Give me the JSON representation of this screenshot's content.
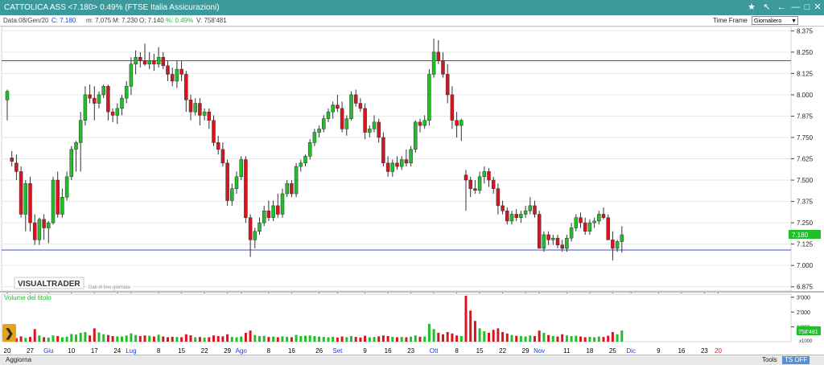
{
  "window": {
    "title": "CATTOLICA ASS <7.180> 0.49%  (FTSE Italia Assicurazioni)",
    "title_bg": "#3d9a9c"
  },
  "info": {
    "date": "Data:08/Gen/20",
    "close": "C: 7.180",
    "min": "m: 7.075",
    "max": "M: 7.230",
    "open": "O: 7.140",
    "pct": "%: 0.49%",
    "volume": "V: 758'481"
  },
  "timeframe": {
    "label": "Time Frame",
    "value": "Giornaliero"
  },
  "branding": {
    "logo": "VISUALTRADER",
    "note": "Dati di fine giornata"
  },
  "volume_panel": {
    "label": "Volume del titolo",
    "ticks": [
      "3'000",
      "2'000",
      "1'000"
    ],
    "unit": "x1000",
    "last_value": "758'481"
  },
  "price_label": "7.180",
  "bottom": {
    "refresh": "Aggiorna",
    "tools": "Tools",
    "tsoff": "TS OFF"
  },
  "colors": {
    "up": "#1fbf2a",
    "down": "#d8141f",
    "hline": "#3a4fd8",
    "volume_up": "#1fbf2a",
    "volume_down": "#d8141f"
  },
  "icons": [
    "star-icon",
    "zoom-arrow-icon",
    "pan-left-icon",
    "minimize-icon",
    "restore-icon",
    "close-icon",
    "expand-arrow-icon"
  ],
  "chart_data": {
    "type": "candlestick",
    "y_ticks": [
      "8.375",
      "8.250",
      "8.125",
      "8.000",
      "7.875",
      "7.750",
      "7.625",
      "7.500",
      "7.375",
      "7.250",
      "7.125",
      "7.000",
      "6.875"
    ],
    "ylim": [
      6.85,
      8.4
    ],
    "horizontal_lines": [
      8.2,
      7.09
    ],
    "x_labels": [
      {
        "text": "20",
        "bar": 0,
        "color": "#000000"
      },
      {
        "text": "27",
        "bar": 5,
        "color": "#000000"
      },
      {
        "text": "Giu",
        "bar": 9,
        "color": "#1a3fd8"
      },
      {
        "text": "10",
        "bar": 14,
        "color": "#000000"
      },
      {
        "text": "17",
        "bar": 19,
        "color": "#000000"
      },
      {
        "text": "24",
        "bar": 24,
        "color": "#000000"
      },
      {
        "text": "Lug",
        "bar": 27,
        "color": "#1a3fd8"
      },
      {
        "text": "8",
        "bar": 33,
        "color": "#000000"
      },
      {
        "text": "15",
        "bar": 38,
        "color": "#000000"
      },
      {
        "text": "22",
        "bar": 43,
        "color": "#000000"
      },
      {
        "text": "29",
        "bar": 48,
        "color": "#000000"
      },
      {
        "text": "Ago",
        "bar": 51,
        "color": "#1a3fd8"
      },
      {
        "text": "8",
        "bar": 57,
        "color": "#000000"
      },
      {
        "text": "16",
        "bar": 62,
        "color": "#000000"
      },
      {
        "text": "26",
        "bar": 68,
        "color": "#000000"
      },
      {
        "text": "Set",
        "bar": 72,
        "color": "#1a3fd8"
      },
      {
        "text": "9",
        "bar": 78,
        "color": "#000000"
      },
      {
        "text": "16",
        "bar": 83,
        "color": "#000000"
      },
      {
        "text": "23",
        "bar": 88,
        "color": "#000000"
      },
      {
        "text": "Ott",
        "bar": 93,
        "color": "#1a3fd8"
      },
      {
        "text": "8",
        "bar": 98,
        "color": "#000000"
      },
      {
        "text": "15",
        "bar": 103,
        "color": "#000000"
      },
      {
        "text": "22",
        "bar": 108,
        "color": "#000000"
      },
      {
        "text": "29",
        "bar": 113,
        "color": "#000000"
      },
      {
        "text": "Nov",
        "bar": 116,
        "color": "#1a3fd8"
      },
      {
        "text": "11",
        "bar": 122,
        "color": "#000000"
      },
      {
        "text": "18",
        "bar": 127,
        "color": "#000000"
      },
      {
        "text": "25",
        "bar": 132,
        "color": "#000000"
      },
      {
        "text": "Dic",
        "bar": 136,
        "color": "#1a3fd8"
      },
      {
        "text": "9",
        "bar": 142,
        "color": "#000000"
      },
      {
        "text": "16",
        "bar": 147,
        "color": "#000000"
      },
      {
        "text": "23",
        "bar": 152,
        "color": "#000000"
      },
      {
        "text": "20",
        "bar": 155,
        "color": "#e0201a"
      }
    ],
    "candles": [
      {
        "o": 7.97,
        "h": 8.03,
        "l": 7.85,
        "c": 8.02,
        "v": 300
      },
      {
        "o": 7.63,
        "h": 7.67,
        "l": 7.58,
        "c": 7.61,
        "v": 250
      },
      {
        "o": 7.6,
        "h": 7.65,
        "l": 7.5,
        "c": 7.55,
        "v": 240
      },
      {
        "o": 7.55,
        "h": 7.58,
        "l": 7.28,
        "c": 7.3,
        "v": 360
      },
      {
        "o": 7.3,
        "h": 7.5,
        "l": 7.2,
        "c": 7.48,
        "v": 260
      },
      {
        "o": 7.48,
        "h": 7.52,
        "l": 7.2,
        "c": 7.25,
        "v": 320
      },
      {
        "o": 7.25,
        "h": 7.3,
        "l": 7.12,
        "c": 7.15,
        "v": 850
      },
      {
        "o": 7.15,
        "h": 7.28,
        "l": 7.12,
        "c": 7.27,
        "v": 420
      },
      {
        "o": 7.27,
        "h": 7.3,
        "l": 7.15,
        "c": 7.22,
        "v": 300
      },
      {
        "o": 7.22,
        "h": 7.26,
        "l": 7.13,
        "c": 7.25,
        "v": 280
      },
      {
        "o": 7.25,
        "h": 7.52,
        "l": 7.24,
        "c": 7.5,
        "v": 420
      },
      {
        "o": 7.5,
        "h": 7.55,
        "l": 7.28,
        "c": 7.3,
        "v": 380
      },
      {
        "o": 7.3,
        "h": 7.45,
        "l": 7.28,
        "c": 7.4,
        "v": 300
      },
      {
        "o": 7.4,
        "h": 7.55,
        "l": 7.38,
        "c": 7.52,
        "v": 340
      },
      {
        "o": 7.52,
        "h": 7.7,
        "l": 7.5,
        "c": 7.68,
        "v": 520
      },
      {
        "o": 7.68,
        "h": 7.73,
        "l": 7.55,
        "c": 7.72,
        "v": 480
      },
      {
        "o": 7.72,
        "h": 7.9,
        "l": 7.55,
        "c": 7.85,
        "v": 600
      },
      {
        "o": 7.85,
        "h": 8.05,
        "l": 7.82,
        "c": 8.0,
        "v": 650
      },
      {
        "o": 8.0,
        "h": 8.06,
        "l": 7.95,
        "c": 7.98,
        "v": 420
      },
      {
        "o": 7.98,
        "h": 8.05,
        "l": 7.85,
        "c": 7.95,
        "v": 900
      },
      {
        "o": 7.95,
        "h": 8.02,
        "l": 7.92,
        "c": 8.0,
        "v": 620
      },
      {
        "o": 8.0,
        "h": 8.06,
        "l": 7.98,
        "c": 8.05,
        "v": 500
      },
      {
        "o": 8.05,
        "h": 8.06,
        "l": 7.85,
        "c": 7.9,
        "v": 450
      },
      {
        "o": 7.9,
        "h": 7.92,
        "l": 7.84,
        "c": 7.88,
        "v": 380
      },
      {
        "o": 7.88,
        "h": 7.95,
        "l": 7.83,
        "c": 7.92,
        "v": 360
      },
      {
        "o": 7.92,
        "h": 8.0,
        "l": 7.88,
        "c": 7.98,
        "v": 350
      },
      {
        "o": 7.98,
        "h": 8.08,
        "l": 7.95,
        "c": 8.05,
        "v": 420
      },
      {
        "o": 8.05,
        "h": 8.22,
        "l": 8.0,
        "c": 8.18,
        "v": 560
      },
      {
        "o": 8.18,
        "h": 8.26,
        "l": 8.12,
        "c": 8.22,
        "v": 450
      },
      {
        "o": 8.22,
        "h": 8.25,
        "l": 8.16,
        "c": 8.2,
        "v": 380
      },
      {
        "o": 8.2,
        "h": 8.3,
        "l": 8.17,
        "c": 8.18,
        "v": 420
      },
      {
        "o": 8.18,
        "h": 8.25,
        "l": 8.15,
        "c": 8.2,
        "v": 400
      },
      {
        "o": 8.2,
        "h": 8.24,
        "l": 8.14,
        "c": 8.18,
        "v": 350
      },
      {
        "o": 8.18,
        "h": 8.28,
        "l": 8.16,
        "c": 8.22,
        "v": 470
      },
      {
        "o": 8.22,
        "h": 8.25,
        "l": 8.15,
        "c": 8.17,
        "v": 350
      },
      {
        "o": 8.17,
        "h": 8.2,
        "l": 8.08,
        "c": 8.12,
        "v": 300
      },
      {
        "o": 8.12,
        "h": 8.16,
        "l": 8.05,
        "c": 8.08,
        "v": 330
      },
      {
        "o": 8.08,
        "h": 8.2,
        "l": 8.04,
        "c": 8.15,
        "v": 320
      },
      {
        "o": 8.15,
        "h": 8.2,
        "l": 8.08,
        "c": 8.12,
        "v": 300
      },
      {
        "o": 8.12,
        "h": 8.14,
        "l": 7.9,
        "c": 7.97,
        "v": 500
      },
      {
        "o": 7.97,
        "h": 8.0,
        "l": 7.85,
        "c": 7.9,
        "v": 430
      },
      {
        "o": 7.9,
        "h": 7.98,
        "l": 7.88,
        "c": 7.95,
        "v": 300
      },
      {
        "o": 7.95,
        "h": 7.98,
        "l": 7.82,
        "c": 7.88,
        "v": 320
      },
      {
        "o": 7.88,
        "h": 7.92,
        "l": 7.85,
        "c": 7.9,
        "v": 280
      },
      {
        "o": 7.9,
        "h": 7.92,
        "l": 7.8,
        "c": 7.85,
        "v": 300
      },
      {
        "o": 7.85,
        "h": 7.88,
        "l": 7.7,
        "c": 7.72,
        "v": 420
      },
      {
        "o": 7.72,
        "h": 7.76,
        "l": 7.65,
        "c": 7.68,
        "v": 380
      },
      {
        "o": 7.68,
        "h": 7.72,
        "l": 7.58,
        "c": 7.6,
        "v": 360
      },
      {
        "o": 7.6,
        "h": 7.62,
        "l": 7.35,
        "c": 7.38,
        "v": 500
      },
      {
        "o": 7.38,
        "h": 7.48,
        "l": 7.35,
        "c": 7.45,
        "v": 320
      },
      {
        "o": 7.45,
        "h": 7.55,
        "l": 7.42,
        "c": 7.52,
        "v": 300
      },
      {
        "o": 7.52,
        "h": 7.64,
        "l": 7.5,
        "c": 7.62,
        "v": 350
      },
      {
        "o": 7.62,
        "h": 7.64,
        "l": 7.25,
        "c": 7.28,
        "v": 600
      },
      {
        "o": 7.28,
        "h": 7.3,
        "l": 7.05,
        "c": 7.15,
        "v": 750
      },
      {
        "o": 7.15,
        "h": 7.22,
        "l": 7.1,
        "c": 7.2,
        "v": 450
      },
      {
        "o": 7.2,
        "h": 7.28,
        "l": 7.18,
        "c": 7.25,
        "v": 380
      },
      {
        "o": 7.25,
        "h": 7.35,
        "l": 7.23,
        "c": 7.32,
        "v": 400
      },
      {
        "o": 7.32,
        "h": 7.38,
        "l": 7.26,
        "c": 7.28,
        "v": 320
      },
      {
        "o": 7.28,
        "h": 7.38,
        "l": 7.26,
        "c": 7.35,
        "v": 340
      },
      {
        "o": 7.35,
        "h": 7.42,
        "l": 7.28,
        "c": 7.3,
        "v": 300
      },
      {
        "o": 7.3,
        "h": 7.45,
        "l": 7.28,
        "c": 7.42,
        "v": 360
      },
      {
        "o": 7.42,
        "h": 7.5,
        "l": 7.4,
        "c": 7.48,
        "v": 330
      },
      {
        "o": 7.48,
        "h": 7.5,
        "l": 7.4,
        "c": 7.42,
        "v": 300
      },
      {
        "o": 7.42,
        "h": 7.6,
        "l": 7.4,
        "c": 7.58,
        "v": 460
      },
      {
        "o": 7.58,
        "h": 7.62,
        "l": 7.55,
        "c": 7.6,
        "v": 380
      },
      {
        "o": 7.6,
        "h": 7.65,
        "l": 7.58,
        "c": 7.64,
        "v": 400
      },
      {
        "o": 7.64,
        "h": 7.74,
        "l": 7.62,
        "c": 7.72,
        "v": 420
      },
      {
        "o": 7.72,
        "h": 7.8,
        "l": 7.7,
        "c": 7.78,
        "v": 380
      },
      {
        "o": 7.78,
        "h": 7.82,
        "l": 7.75,
        "c": 7.8,
        "v": 340
      },
      {
        "o": 7.8,
        "h": 7.88,
        "l": 7.78,
        "c": 7.86,
        "v": 320
      },
      {
        "o": 7.86,
        "h": 7.92,
        "l": 7.84,
        "c": 7.9,
        "v": 300
      },
      {
        "o": 7.9,
        "h": 7.96,
        "l": 7.86,
        "c": 7.94,
        "v": 330
      },
      {
        "o": 7.94,
        "h": 8.0,
        "l": 7.9,
        "c": 7.92,
        "v": 280
      },
      {
        "o": 7.92,
        "h": 7.96,
        "l": 7.78,
        "c": 7.8,
        "v": 350
      },
      {
        "o": 7.8,
        "h": 7.88,
        "l": 7.76,
        "c": 7.86,
        "v": 300
      },
      {
        "o": 7.86,
        "h": 8.02,
        "l": 7.85,
        "c": 8.0,
        "v": 380
      },
      {
        "o": 8.0,
        "h": 8.03,
        "l": 7.93,
        "c": 7.95,
        "v": 320
      },
      {
        "o": 7.95,
        "h": 7.98,
        "l": 7.9,
        "c": 7.92,
        "v": 280
      },
      {
        "o": 7.92,
        "h": 7.95,
        "l": 7.74,
        "c": 7.78,
        "v": 400
      },
      {
        "o": 7.78,
        "h": 7.82,
        "l": 7.75,
        "c": 7.8,
        "v": 300
      },
      {
        "o": 7.8,
        "h": 7.88,
        "l": 7.78,
        "c": 7.84,
        "v": 320
      },
      {
        "o": 7.84,
        "h": 7.86,
        "l": 7.72,
        "c": 7.75,
        "v": 360
      },
      {
        "o": 7.75,
        "h": 7.78,
        "l": 7.58,
        "c": 7.6,
        "v": 420
      },
      {
        "o": 7.6,
        "h": 7.64,
        "l": 7.52,
        "c": 7.55,
        "v": 380
      },
      {
        "o": 7.55,
        "h": 7.62,
        "l": 7.52,
        "c": 7.6,
        "v": 330
      },
      {
        "o": 7.6,
        "h": 7.64,
        "l": 7.56,
        "c": 7.58,
        "v": 300
      },
      {
        "o": 7.58,
        "h": 7.64,
        "l": 7.56,
        "c": 7.62,
        "v": 320
      },
      {
        "o": 7.62,
        "h": 7.68,
        "l": 7.58,
        "c": 7.6,
        "v": 300
      },
      {
        "o": 7.6,
        "h": 7.7,
        "l": 7.58,
        "c": 7.68,
        "v": 340
      },
      {
        "o": 7.68,
        "h": 7.85,
        "l": 7.66,
        "c": 7.84,
        "v": 420
      },
      {
        "o": 7.84,
        "h": 7.86,
        "l": 7.78,
        "c": 7.82,
        "v": 330
      },
      {
        "o": 7.82,
        "h": 7.88,
        "l": 7.8,
        "c": 7.85,
        "v": 350
      },
      {
        "o": 7.85,
        "h": 8.15,
        "l": 7.82,
        "c": 8.12,
        "v": 1200
      },
      {
        "o": 8.12,
        "h": 8.33,
        "l": 8.1,
        "c": 8.25,
        "v": 850
      },
      {
        "o": 8.25,
        "h": 8.32,
        "l": 8.18,
        "c": 8.2,
        "v": 600
      },
      {
        "o": 8.2,
        "h": 8.25,
        "l": 8.1,
        "c": 8.12,
        "v": 500
      },
      {
        "o": 8.12,
        "h": 8.18,
        "l": 7.95,
        "c": 8.0,
        "v": 650
      },
      {
        "o": 8.0,
        "h": 8.05,
        "l": 7.8,
        "c": 7.85,
        "v": 550
      },
      {
        "o": 7.85,
        "h": 7.9,
        "l": 7.75,
        "c": 7.82,
        "v": 420
      },
      {
        "o": 7.82,
        "h": 7.86,
        "l": 7.73,
        "c": 7.85,
        "v": 380
      },
      {
        "o": 7.53,
        "h": 7.56,
        "l": 7.32,
        "c": 7.5,
        "v": 3100
      },
      {
        "o": 7.5,
        "h": 7.52,
        "l": 7.4,
        "c": 7.45,
        "v": 2100
      },
      {
        "o": 7.45,
        "h": 7.5,
        "l": 7.42,
        "c": 7.44,
        "v": 1400
      },
      {
        "o": 7.44,
        "h": 7.55,
        "l": 7.42,
        "c": 7.52,
        "v": 900
      },
      {
        "o": 7.52,
        "h": 7.58,
        "l": 7.48,
        "c": 7.55,
        "v": 700
      },
      {
        "o": 7.55,
        "h": 7.57,
        "l": 7.46,
        "c": 7.5,
        "v": 600
      },
      {
        "o": 7.5,
        "h": 7.52,
        "l": 7.42,
        "c": 7.45,
        "v": 800
      },
      {
        "o": 7.45,
        "h": 7.48,
        "l": 7.3,
        "c": 7.35,
        "v": 900
      },
      {
        "o": 7.35,
        "h": 7.38,
        "l": 7.3,
        "c": 7.32,
        "v": 650
      },
      {
        "o": 7.32,
        "h": 7.34,
        "l": 7.24,
        "c": 7.26,
        "v": 550
      },
      {
        "o": 7.26,
        "h": 7.32,
        "l": 7.24,
        "c": 7.3,
        "v": 450
      },
      {
        "o": 7.3,
        "h": 7.33,
        "l": 7.26,
        "c": 7.28,
        "v": 400
      },
      {
        "o": 7.28,
        "h": 7.32,
        "l": 7.25,
        "c": 7.3,
        "v": 380
      },
      {
        "o": 7.3,
        "h": 7.35,
        "l": 7.28,
        "c": 7.32,
        "v": 350
      },
      {
        "o": 7.32,
        "h": 7.4,
        "l": 7.3,
        "c": 7.35,
        "v": 420
      },
      {
        "o": 7.35,
        "h": 7.38,
        "l": 7.28,
        "c": 7.3,
        "v": 380
      },
      {
        "o": 7.3,
        "h": 7.32,
        "l": 7.1,
        "c": 7.1,
        "v": 750
      },
      {
        "o": 7.1,
        "h": 7.2,
        "l": 7.08,
        "c": 7.18,
        "v": 600
      },
      {
        "o": 7.18,
        "h": 7.2,
        "l": 7.12,
        "c": 7.15,
        "v": 450
      },
      {
        "o": 7.15,
        "h": 7.18,
        "l": 7.12,
        "c": 7.16,
        "v": 380
      },
      {
        "o": 7.16,
        "h": 7.18,
        "l": 7.1,
        "c": 7.12,
        "v": 350
      },
      {
        "o": 7.12,
        "h": 7.15,
        "l": 7.08,
        "c": 7.1,
        "v": 500
      },
      {
        "o": 7.1,
        "h": 7.18,
        "l": 7.08,
        "c": 7.16,
        "v": 420
      },
      {
        "o": 7.16,
        "h": 7.25,
        "l": 7.14,
        "c": 7.22,
        "v": 380
      },
      {
        "o": 7.22,
        "h": 7.3,
        "l": 7.2,
        "c": 7.28,
        "v": 400
      },
      {
        "o": 7.28,
        "h": 7.31,
        "l": 7.22,
        "c": 7.25,
        "v": 350
      },
      {
        "o": 7.25,
        "h": 7.28,
        "l": 7.18,
        "c": 7.2,
        "v": 300
      },
      {
        "o": 7.2,
        "h": 7.27,
        "l": 7.18,
        "c": 7.25,
        "v": 330
      },
      {
        "o": 7.25,
        "h": 7.28,
        "l": 7.22,
        "c": 7.26,
        "v": 300
      },
      {
        "o": 7.26,
        "h": 7.32,
        "l": 7.24,
        "c": 7.3,
        "v": 350
      },
      {
        "o": 7.3,
        "h": 7.34,
        "l": 7.27,
        "c": 7.28,
        "v": 320
      },
      {
        "o": 7.28,
        "h": 7.3,
        "l": 7.15,
        "c": 7.15,
        "v": 400
      },
      {
        "o": 7.15,
        "h": 7.2,
        "l": 7.03,
        "c": 7.1,
        "v": 650
      },
      {
        "o": 7.1,
        "h": 7.15,
        "l": 7.08,
        "c": 7.14,
        "v": 500
      },
      {
        "o": 7.14,
        "h": 7.23,
        "l": 7.075,
        "c": 7.18,
        "v": 758
      }
    ]
  }
}
